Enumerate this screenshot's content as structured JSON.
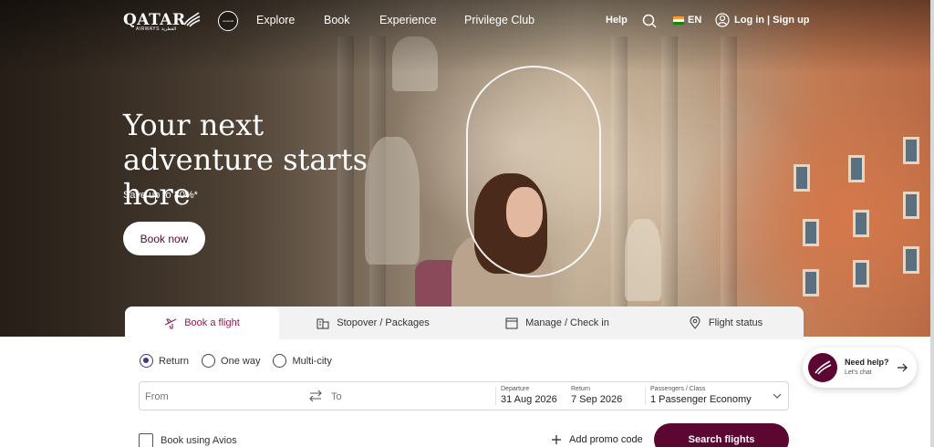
{
  "brand": {
    "name": "QATAR",
    "subtitle": "AIRWAYS القطرية",
    "alliance_icon": "oneworld-icon"
  },
  "nav": {
    "links": [
      "Explore",
      "Book",
      "Experience",
      "Privilege Club"
    ],
    "help": "Help",
    "language": "EN",
    "login": "Log in | Sign up"
  },
  "hero": {
    "title": "Your next adventure starts here",
    "subtitle": "Save up to 30%*",
    "cta": "Book now"
  },
  "tabs": [
    {
      "label": "Book a flight",
      "icon": "plane-icon",
      "active": true
    },
    {
      "label": "Stopover / Packages",
      "icon": "building-icon",
      "active": false
    },
    {
      "label": "Manage / Check in",
      "icon": "calendar-icon",
      "active": false
    },
    {
      "label": "Flight status",
      "icon": "location-pin-icon",
      "active": false
    }
  ],
  "booking": {
    "trip_types": [
      "Return",
      "One way",
      "Multi-city"
    ],
    "selected_trip_type": "Return",
    "from_placeholder": "From",
    "to_placeholder": "To",
    "departure_label": "Departure",
    "departure_value": "31 Aug 2026",
    "return_label": "Return",
    "return_value": "7 Sep 2026",
    "passengers_label": "Passengers / Class",
    "passengers_value": "1 Passenger Economy",
    "avios_label": "Book using Avios",
    "promo_label": "Add promo code",
    "search_label": "Search flights"
  },
  "help_chat": {
    "title": "Need help?",
    "subtitle": "Let's chat"
  },
  "colors": {
    "brand_primary": "#5c0632",
    "accent": "#8e1c54",
    "radio_selected": "#3a3a8a"
  }
}
